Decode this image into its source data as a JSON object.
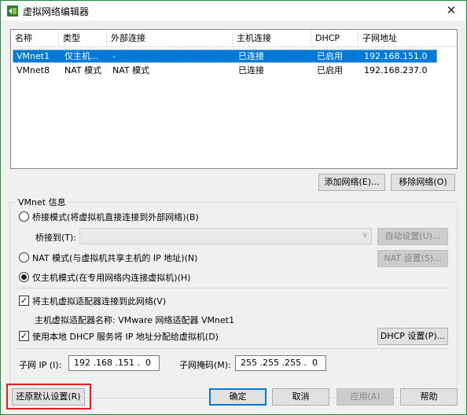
{
  "window": {
    "title": "虚拟网络编辑器",
    "close": "✕"
  },
  "list": {
    "columns": [
      "名称",
      "类型",
      "外部连接",
      "主机连接",
      "DHCP",
      "子网地址"
    ],
    "rows": [
      {
        "name": "VMnet1",
        "type": "仅主机...",
        "external": "-",
        "host": "已连接",
        "dhcp": "已启用",
        "subnet": "192.168.151.0",
        "selected": true
      },
      {
        "name": "VMnet8",
        "type": "NAT 模式",
        "external": "NAT 模式",
        "host": "已连接",
        "dhcp": "已启用",
        "subnet": "192.168.237.0",
        "selected": false
      }
    ]
  },
  "buttons": {
    "add_network": "添加网络(E)...",
    "remove_network": "移除网络(O)",
    "auto_settings": "自动设置(U)...",
    "nat_settings": "NAT 设置(S)...",
    "dhcp_settings": "DHCP 设置(P)...",
    "restore_defaults": "还原默认设置(R)",
    "ok": "确定",
    "cancel": "取消",
    "apply": "应用(A)",
    "help": "帮助"
  },
  "info": {
    "group_label": "VMnet 信息",
    "bridged": "桥接模式(将虚拟机直接连接到外部网络)(B)",
    "bridge_to": "桥接到(T):",
    "nat": "NAT 模式(与虚拟机共享主机的 IP 地址)(N)",
    "host_only": "仅主机模式(在专用网络内连接虚拟机)(H)",
    "connect_adapter": "将主机虚拟适配器连接到此网络(V)",
    "adapter_name": "主机虚拟适配器名称: VMware 网络适配器 VMnet1",
    "use_dhcp": "使用本地 DHCP 服务将 IP 地址分配给虚拟机(D)",
    "subnet_ip_label": "子网 IP (I):",
    "subnet_ip": "192 .168 .151 .  0",
    "subnet_mask_label": "子网掩码(M):",
    "subnet_mask": "255 .255 .255 .  0",
    "check_mark": "✓"
  }
}
